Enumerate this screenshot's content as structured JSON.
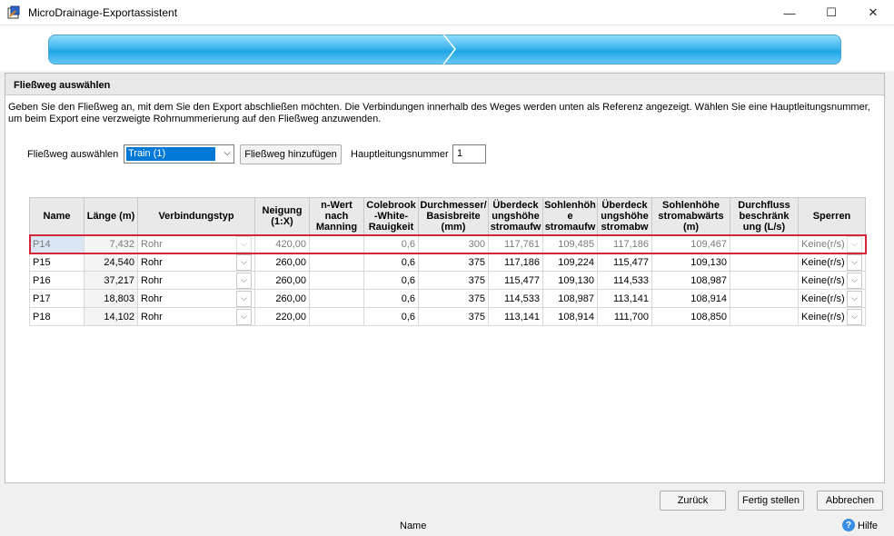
{
  "window": {
    "title": "MicroDrainage-Exportassistent",
    "minimize": "—",
    "maximize": "☐",
    "close": "✕"
  },
  "panel": {
    "header": "Fließweg auswählen",
    "description": "Geben Sie den Fließweg an, mit dem Sie den Export abschließen möchten. Die Verbindungen innerhalb des Weges werden unten als Referenz angezeigt. Wählen Sie eine Hauptleitungsnummer, um beim Export eine verzweigte Rohrnummerierung auf den Fließweg anzuwenden."
  },
  "controls": {
    "flow_label": "Fließweg auswählen",
    "flow_value": "Train (1)",
    "add_button": "Fließweg hinzufügen",
    "main_label": "Hauptleitungsnummer",
    "main_value": "1"
  },
  "table": {
    "headers": [
      "Name",
      "Länge (m)",
      "Verbindungstyp",
      "Neigung (1:X)",
      "n-Wert nach Manning",
      "Colebrook -White-Rauigkeit",
      "Durchmesser/ Basisbreite (mm)",
      "Überdeck ungshöhe stromaufw",
      "Sohlenhöh e stromaufw",
      "Überdeck ungshöhe stromabw",
      "Sohlenhöhe stromabwärts (m)",
      "Durchfluss beschränk ung (L/s)",
      "Sperren"
    ],
    "rows": [
      {
        "name": "P14",
        "laenge": "7,432",
        "typ": "Rohr",
        "neigung": "420,00",
        "manning": "",
        "colebrook": "0,6",
        "durchmesser": "300",
        "ue_auf": "117,761",
        "sohle_auf": "109,485",
        "ue_ab": "117,186",
        "sohle_ab": "109,467",
        "durchfluss": "",
        "sperren": "Keine(r/s)"
      },
      {
        "name": "P15",
        "laenge": "24,540",
        "typ": "Rohr",
        "neigung": "260,00",
        "manning": "",
        "colebrook": "0,6",
        "durchmesser": "375",
        "ue_auf": "117,186",
        "sohle_auf": "109,224",
        "ue_ab": "115,477",
        "sohle_ab": "109,130",
        "durchfluss": "",
        "sperren": "Keine(r/s)"
      },
      {
        "name": "P16",
        "laenge": "37,217",
        "typ": "Rohr",
        "neigung": "260,00",
        "manning": "",
        "colebrook": "0,6",
        "durchmesser": "375",
        "ue_auf": "115,477",
        "sohle_auf": "109,130",
        "ue_ab": "114,533",
        "sohle_ab": "108,987",
        "durchfluss": "",
        "sperren": "Keine(r/s)"
      },
      {
        "name": "P17",
        "laenge": "18,803",
        "typ": "Rohr",
        "neigung": "260,00",
        "manning": "",
        "colebrook": "0,6",
        "durchmesser": "375",
        "ue_auf": "114,533",
        "sohle_auf": "108,987",
        "ue_ab": "113,141",
        "sohle_ab": "108,914",
        "durchfluss": "",
        "sperren": "Keine(r/s)"
      },
      {
        "name": "P18",
        "laenge": "14,102",
        "typ": "Rohr",
        "neigung": "220,00",
        "manning": "",
        "colebrook": "0,6",
        "durchmesser": "375",
        "ue_auf": "113,141",
        "sohle_auf": "108,914",
        "ue_ab": "111,700",
        "sohle_ab": "108,850",
        "durchfluss": "",
        "sperren": "Keine(r/s)"
      }
    ]
  },
  "footer": {
    "back": "Zurück",
    "finish": "Fertig stellen",
    "cancel": "Abbrechen",
    "status_name": "Name",
    "help": "Hilfe"
  }
}
